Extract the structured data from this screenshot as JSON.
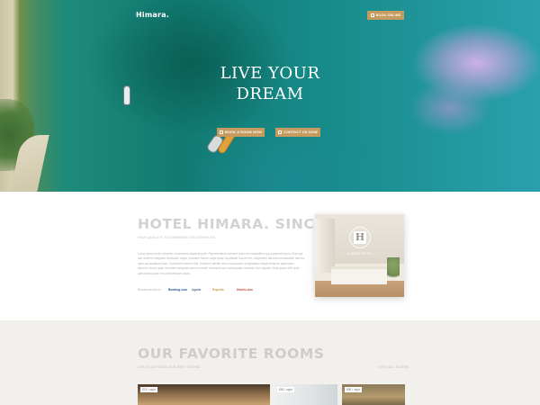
{
  "header": {
    "logo": "Himara.",
    "book_online": "BOOK ONLINE"
  },
  "hero": {
    "title_line1": "LIVE YOUR",
    "title_line2": "DREAM",
    "btn_book": "BOOK A ROOM NOW",
    "btn_contact": "CONTACT US NOW"
  },
  "about": {
    "title": "HOTEL HIMARA. SINCE 1996",
    "subtitle": "HIGH QUALITY ACCOMMODATION SERVICES",
    "body": "Lorem ipsum dolor sit amet, consectetur adipiscing elit. Reprehenderit dolorem nulla vel voluptatibus quos placeat ipsum. Eum qui iure dolorem magnam explicabo, atque provident facere culpa quasi cupiditate! Dolore est, voluptatem laborum recusandae dolores quos accusantium illum. Commodi maxime nihil. Deserunt debitis nemo accusamus voluptatibus itaque tempore aspernatur laborum. Animi quae velit alias voluptate earum eveniet commodi nam consequatur nesciunt iure impedit. Nulla quam nihil unde quibusdam quae vero doloremque soluta.",
    "recommended": "Recommended on",
    "partners": [
      {
        "name": "Booking.com",
        "color": "#2d4f9a"
      },
      {
        "name": "Agoda",
        "color": "#5a6f9f"
      },
      {
        "name": "Expedia",
        "color": "#c9a24a"
      },
      {
        "name": "Hotels.com",
        "color": "#c9473b"
      }
    ],
    "emblem_letter": "H",
    "emblem_text": "HIMARA HOTEL"
  },
  "rooms": {
    "title": "OUR FAVORITE ROOMS",
    "subtitle": "CHECK OUT NOW OUR BEST ROOMS",
    "view_all": "VIEW ALL ROOMS",
    "cards": [
      {
        "price": "$79 / night"
      },
      {
        "price": "$89 / night"
      },
      {
        "price": "$99 / night"
      }
    ]
  },
  "colors": {
    "accent": "#c69b5f",
    "section_bg": "#f2f0ed",
    "title_gray": "#d2d2d2"
  }
}
